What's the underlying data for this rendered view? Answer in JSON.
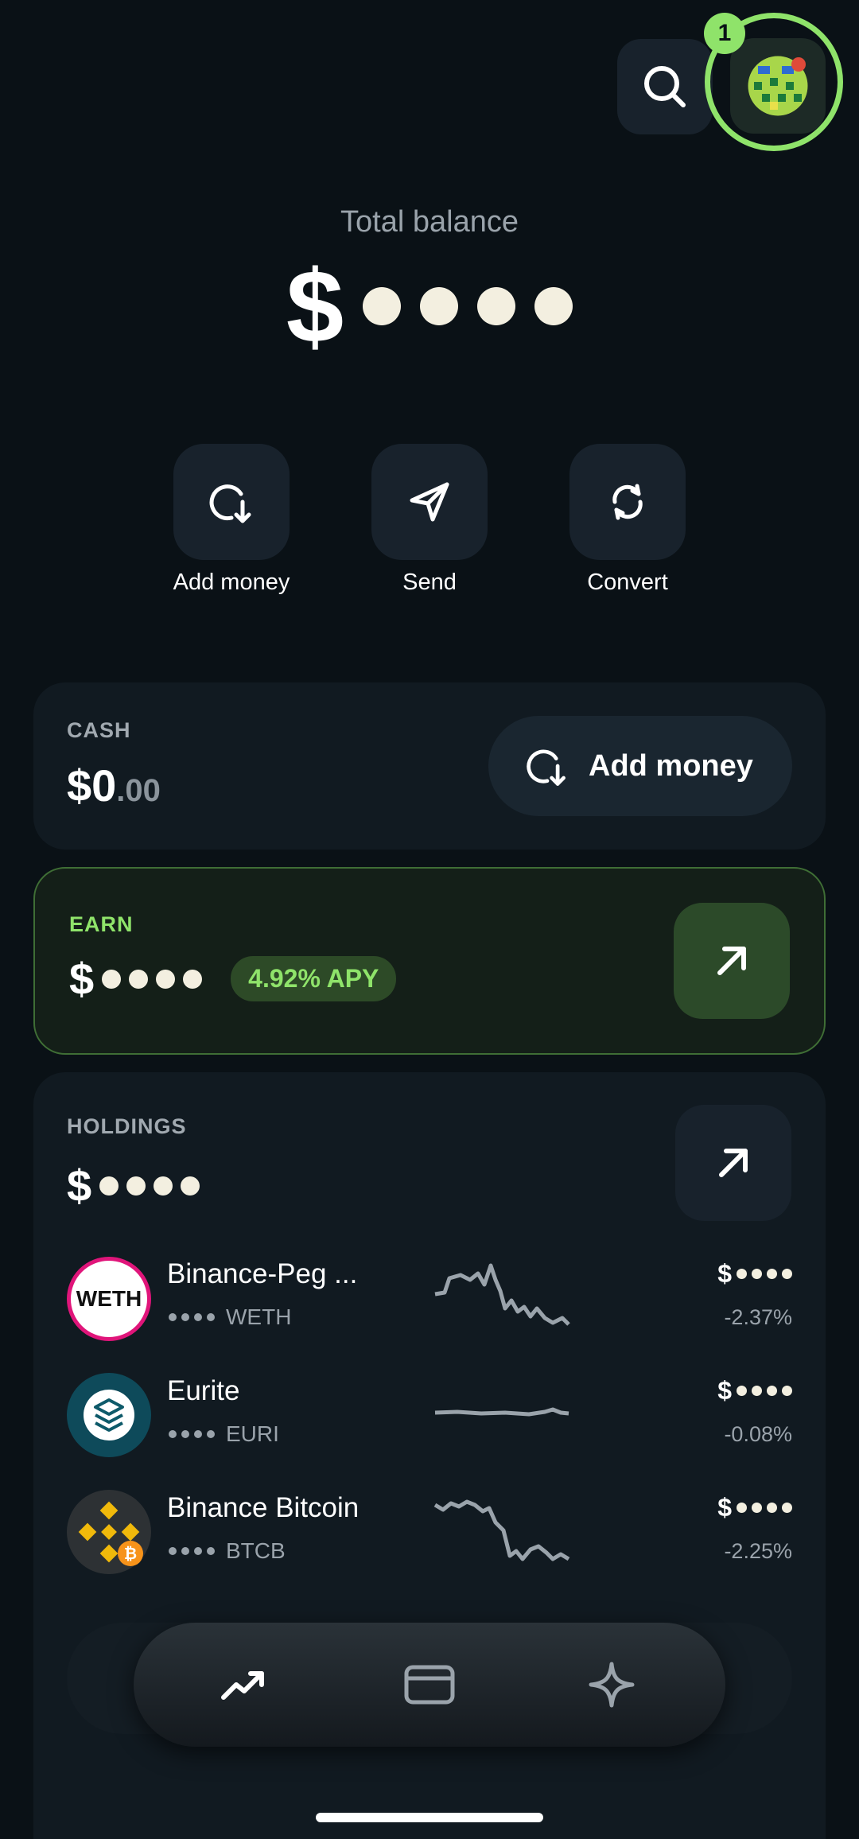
{
  "header": {
    "notification_count": "1",
    "avatar_icon": "pixel-avatar-icon",
    "search_icon": "search-icon"
  },
  "balance": {
    "label": "Total balance",
    "currency": "$"
  },
  "actions": [
    {
      "label": "Add money",
      "icon": "add-money-icon"
    },
    {
      "label": "Send",
      "icon": "send-icon"
    },
    {
      "label": "Convert",
      "icon": "convert-icon"
    }
  ],
  "cash": {
    "label": "CASH",
    "amount_whole": "$0",
    "amount_cents": ".00",
    "button_label": "Add money"
  },
  "earn": {
    "label": "EARN",
    "currency": "$",
    "apy": "4.92% APY"
  },
  "holdings": {
    "label": "HOLDINGS",
    "currency": "$",
    "rows": [
      {
        "name": "Binance-Peg ...",
        "ticker": "WETH",
        "change": "-2.37%",
        "currency": "$",
        "logo_text": "WETH"
      },
      {
        "name": "Eurite",
        "ticker": "EURI",
        "change": "-0.08%",
        "currency": "$"
      },
      {
        "name": "Binance Bitcoin",
        "ticker": "BTCB",
        "change": "-2.25%",
        "currency": "$"
      }
    ]
  },
  "nav": [
    {
      "icon": "trending-icon"
    },
    {
      "icon": "card-icon"
    },
    {
      "icon": "sparkle-icon"
    }
  ],
  "colors": {
    "accent": "#8fe36a",
    "background": "#0a1116",
    "card": "#111a21"
  }
}
